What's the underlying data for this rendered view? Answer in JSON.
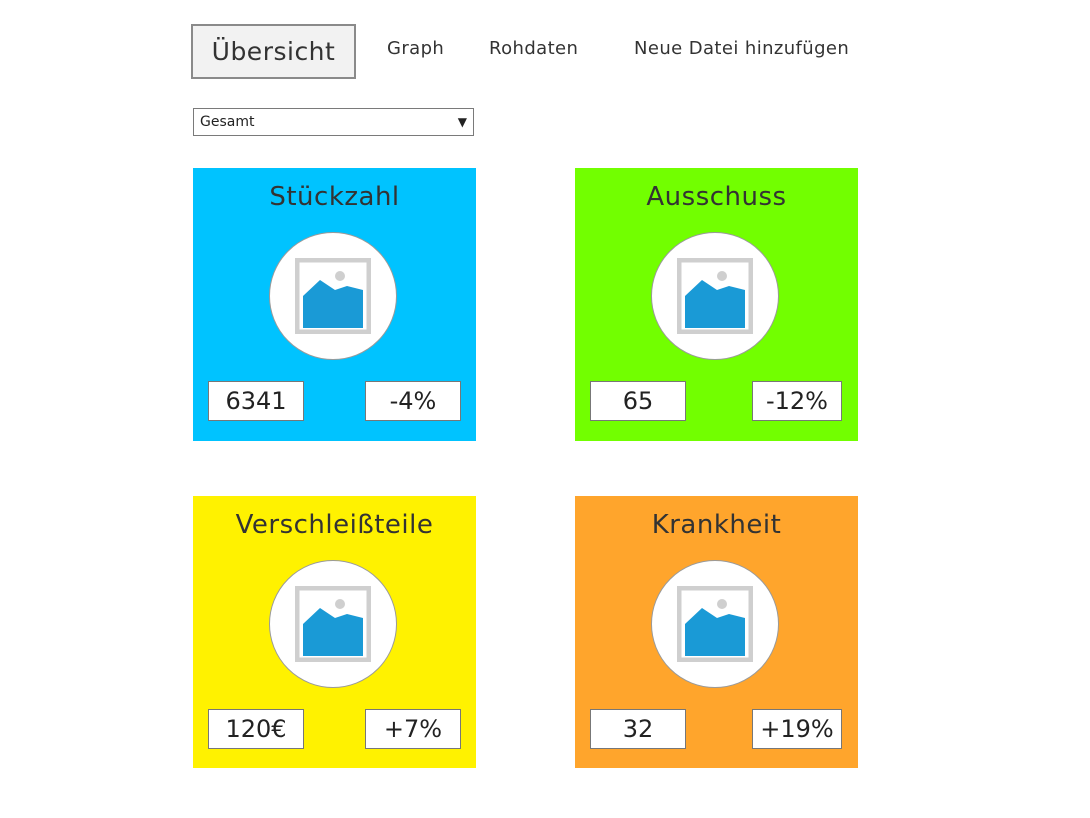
{
  "nav": {
    "overview": "Übersicht",
    "graph": "Graph",
    "raw": "Rohdaten",
    "add_file": "Neue Datei hinzufügen"
  },
  "filter": {
    "selected": "Gesamt"
  },
  "cards": [
    {
      "title": "Stückzahl",
      "value": "6341",
      "change": "-4%",
      "color": "#00c3ff",
      "icon": "image-placeholder-icon"
    },
    {
      "title": "Ausschuss",
      "value": "65",
      "change": "-12%",
      "color": "#72ff00",
      "icon": "image-placeholder-icon"
    },
    {
      "title": "Verschleißteile",
      "value": "120€",
      "change": "+7%",
      "color": "#fff200",
      "icon": "image-placeholder-icon"
    },
    {
      "title": "Krankheit",
      "value": "32",
      "change": "+19%",
      "color": "#ffa52c",
      "icon": "image-placeholder-icon"
    }
  ]
}
